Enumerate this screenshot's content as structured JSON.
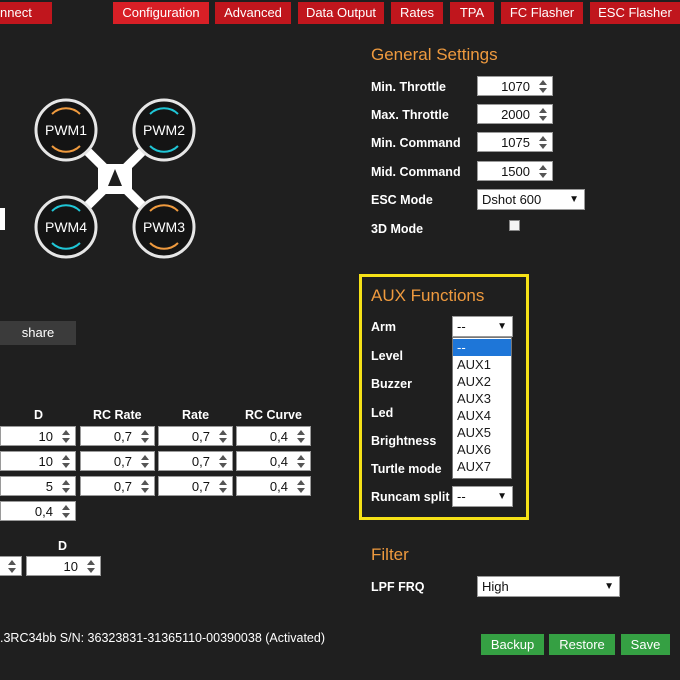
{
  "nav": {
    "connect": "nnect",
    "tabs": [
      "Configuration",
      "Advanced",
      "Data Output",
      "Rates",
      "TPA",
      "FC Flasher",
      "ESC Flasher"
    ]
  },
  "motors": [
    "PWM1",
    "PWM2",
    "PWM4",
    "PWM3"
  ],
  "share_label": "share",
  "general": {
    "title": "General Settings",
    "rows": [
      {
        "label": "Min. Throttle",
        "value": "1070"
      },
      {
        "label": "Max. Throttle",
        "value": "2000"
      },
      {
        "label": "Min. Command",
        "value": "1075"
      },
      {
        "label": "Mid. Command",
        "value": "1500"
      }
    ],
    "esc_mode_label": "ESC Mode",
    "esc_mode_value": "Dshot 600",
    "mode3d_label": "3D Mode"
  },
  "aux": {
    "title": "AUX Functions",
    "labels": [
      "Arm",
      "Level",
      "Buzzer",
      "Led",
      "Brightness",
      "Turtle mode",
      "Runcam split"
    ],
    "arm_value": "--",
    "runcam_value": "--",
    "dropdown_options": [
      "--",
      "AUX1",
      "AUX2",
      "AUX3",
      "AUX4",
      "AUX5",
      "AUX6",
      "AUX7"
    ]
  },
  "pid": {
    "headers": [
      "D",
      "RC Rate",
      "Rate",
      "RC Curve"
    ],
    "rows": [
      [
        "10",
        "0,7",
        "0,7",
        "0,4"
      ],
      [
        "10",
        "0,7",
        "0,7",
        "0,4"
      ],
      [
        "5",
        "0,7",
        "0,7",
        "0,4"
      ]
    ],
    "extra_value": "0,4",
    "sub_header": "D",
    "sub_value": "10"
  },
  "filter": {
    "title": "Filter",
    "lpf_label": "LPF FRQ",
    "lpf_value": "High"
  },
  "footer": {
    "status": ".3RC34bb S/N: 36323831-31365110-00390038 (Activated)",
    "backup": "Backup",
    "restore": "Restore",
    "save": "Save"
  },
  "colors": {
    "nav_red": "#c0161d",
    "section_orange": "#ef9a3e",
    "highlight_yellow": "#f5e117",
    "button_green": "#35a043",
    "cw_arrow": "#ef9a3e",
    "ccw_arrow": "#1fc6d6"
  }
}
